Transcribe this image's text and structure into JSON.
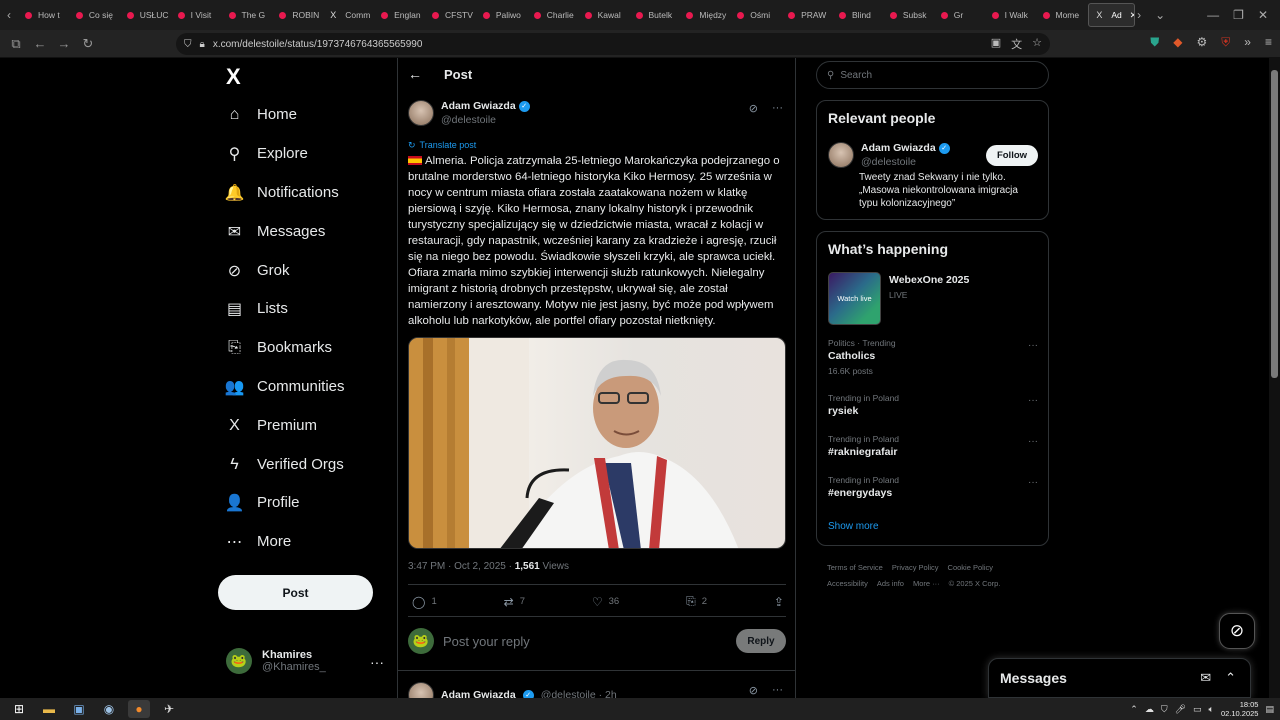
{
  "browser": {
    "tabs": [
      {
        "title": "How t",
        "icon": "dot"
      },
      {
        "title": "Co się",
        "icon": "dot"
      },
      {
        "title": "USŁUC",
        "icon": "dot"
      },
      {
        "title": "I Visit",
        "icon": "dot"
      },
      {
        "title": "The G",
        "icon": "dot"
      },
      {
        "title": "ROBIN",
        "icon": "dot"
      },
      {
        "title": "Comm",
        "icon": "x"
      },
      {
        "title": "Englan",
        "icon": "dot"
      },
      {
        "title": "CFSTV",
        "icon": "dot"
      },
      {
        "title": "Paliwo",
        "icon": "dot"
      },
      {
        "title": "Charlie",
        "icon": "dot"
      },
      {
        "title": "Kawal",
        "icon": "dot"
      },
      {
        "title": "Butelk",
        "icon": "dot"
      },
      {
        "title": "Między",
        "icon": "dot"
      },
      {
        "title": "Ośmi",
        "icon": "dot"
      },
      {
        "title": "PRAW",
        "icon": "dot"
      },
      {
        "title": "Blind",
        "icon": "dot"
      },
      {
        "title": "Subsk",
        "icon": "dot"
      },
      {
        "title": "Gr",
        "icon": "dot"
      },
      {
        "title": "I Walk",
        "icon": "dot"
      },
      {
        "title": "Mome",
        "icon": "dot"
      },
      {
        "title": "Ad",
        "icon": "x",
        "active": true
      }
    ],
    "url": "x.com/delestoile/status/1973746764365565990"
  },
  "sidebar": {
    "logo": "X",
    "items": [
      {
        "label": "Home",
        "icon": "⌂"
      },
      {
        "label": "Explore",
        "icon": "⚲"
      },
      {
        "label": "Notifications",
        "icon": "🔔"
      },
      {
        "label": "Messages",
        "icon": "✉"
      },
      {
        "label": "Grok",
        "icon": "⊘"
      },
      {
        "label": "Lists",
        "icon": "▤"
      },
      {
        "label": "Bookmarks",
        "icon": "⎘"
      },
      {
        "label": "Communities",
        "icon": "👥"
      },
      {
        "label": "Premium",
        "icon": "X"
      },
      {
        "label": "Verified Orgs",
        "icon": "ϟ"
      },
      {
        "label": "Profile",
        "icon": "👤"
      },
      {
        "label": "More",
        "icon": "⋯"
      }
    ],
    "post_button": "Post",
    "account": {
      "name": "Khamires",
      "handle": "@Khamires_"
    }
  },
  "main": {
    "header_title": "Post",
    "author": {
      "name": "Adam Gwiazda",
      "handle": "@delestoile"
    },
    "translate": "Translate post",
    "text": "Almeria. Policja zatrzymała 25-letniego Marokańczyka podejrzanego o brutalne morderstwo 64-letniego historyka Kiko Hermosy. 25 września w nocy w centrum miasta ofiara została zaatakowana nożem w klatkę piersiową i szyję. Kiko Hermosa, znany lokalny historyk i przewodnik turystyczny specjalizujący się w dziedzictwie miasta, wracał z kolacji w restauracji, gdy napastnik, wcześniej karany za kradzieże i agresję, rzucił się na niego bez powodu. Świadkowie słyszeli krzyki, ale sprawca uciekł. Ofiara zmarła mimo szybkiej interwencji służb ratunkowych. Nielegalny imigrant z historią drobnych przestępstw, ukrywał się, ale został namierzony i aresztowany. Motyw nie jest jasny, być może pod wpływem alkoholu lub narkotyków, ale portfel ofiary pozostał nietknięty.",
    "meta_time": "3:47 PM · Oct 2, 2025 · ",
    "views_count": "1,561",
    "views_label": " Views",
    "actions": {
      "replies": "1",
      "reposts": "7",
      "likes": "36",
      "bookmarks": "2"
    },
    "reply_placeholder": "Post your reply",
    "reply_button": "Reply",
    "next": {
      "name": "Adam Gwiazda",
      "handle": "@delestoile · 2h"
    }
  },
  "right": {
    "search_placeholder": "Search",
    "relevant_title": "Relevant people",
    "person": {
      "name": "Adam Gwiazda",
      "handle": "@delestoile",
      "follow": "Follow",
      "bio": "Tweety znad Sekwany i nie tylko. „Masowa niekontrolowana imigracja typu kolonizacyjnego”"
    },
    "happening_title": "What’s happening",
    "event": {
      "title": "WebexOne 2025",
      "sub": "LIVE",
      "thumb_text": "Watch live"
    },
    "trends": [
      {
        "category": "Politics · Trending",
        "title": "Catholics",
        "count": "16.6K posts"
      },
      {
        "category": "Trending in Poland",
        "title": "rysiek",
        "count": ""
      },
      {
        "category": "Trending in Poland",
        "title": "#rakniegrafair",
        "count": ""
      },
      {
        "category": "Trending in Poland",
        "title": "#energydays",
        "count": ""
      }
    ],
    "show_more": "Show more",
    "footer": [
      "Terms of Service",
      "Privacy Policy",
      "Cookie Policy",
      "Accessibility",
      "Ads info",
      "More ···",
      "© 2025 X Corp."
    ]
  },
  "messages_dock": {
    "title": "Messages"
  },
  "taskbar": {
    "time": "18:05",
    "date": "02.10.2025"
  }
}
